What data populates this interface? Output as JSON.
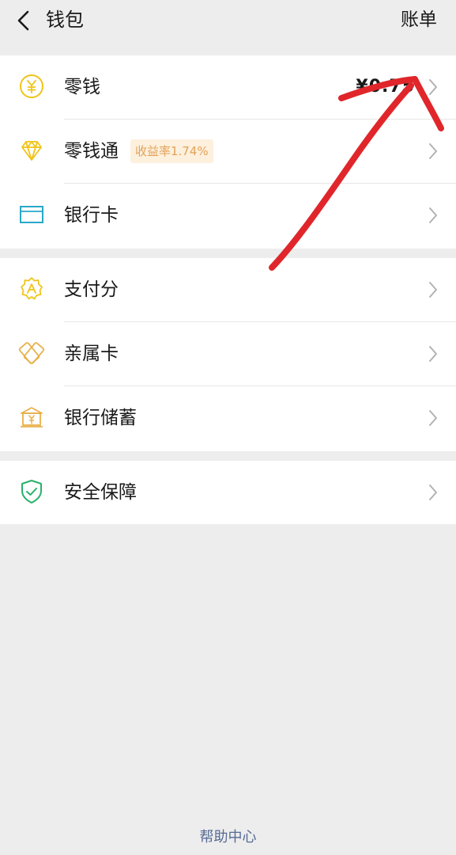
{
  "header": {
    "title": "钱包",
    "bill_label": "账单"
  },
  "groups": [
    {
      "items": [
        {
          "label": "零钱",
          "icon": "yuan-coin-icon",
          "value": "¥0.75"
        },
        {
          "label": "零钱通",
          "icon": "diamond-icon",
          "badge": "收益率1.74%"
        },
        {
          "label": "银行卡",
          "icon": "bank-card-icon"
        }
      ]
    },
    {
      "items": [
        {
          "label": "支付分",
          "icon": "credit-score-badge-icon"
        },
        {
          "label": "亲属卡",
          "icon": "family-card-icon"
        },
        {
          "label": "银行储蓄",
          "icon": "bank-building-icon"
        }
      ]
    },
    {
      "items": [
        {
          "label": "安全保障",
          "icon": "shield-check-icon"
        }
      ]
    }
  ],
  "footer": {
    "help_label": "帮助中心"
  },
  "colors": {
    "background": "#ededed",
    "yellow_icon": "#f0c419",
    "blue_icon": "#2aa7c9",
    "green_icon": "#28b26b",
    "badge_bg": "#fdf0dd",
    "badge_text": "#e3a25a",
    "link": "#576b95",
    "annotation_red": "#e0262b"
  }
}
